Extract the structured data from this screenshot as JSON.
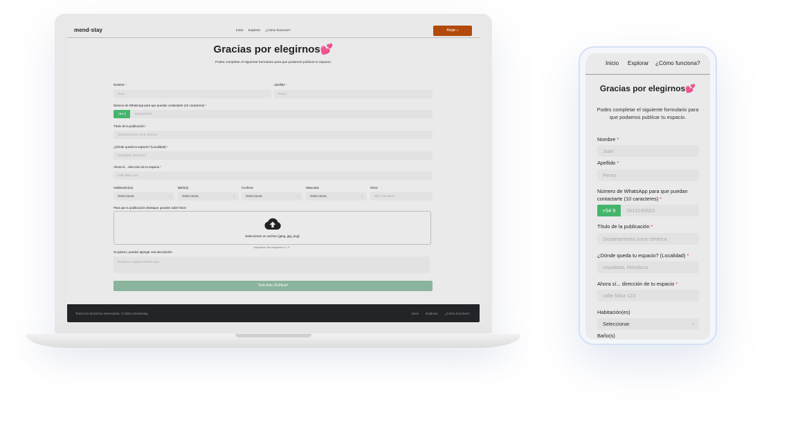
{
  "site": {
    "brand_left": "mend",
    "brand_sep": "•",
    "brand_right": "stay",
    "nav": [
      "Inicio",
      "Explorar",
      "¿Cómo funciona?"
    ],
    "cta_label": "Alojar",
    "cta_icon": "home-icon",
    "accent": "#b24a0b"
  },
  "form": {
    "title": "Gracias por elegirnos",
    "title_emoji": "💕",
    "subtitle": "Podes completar el siguiente formulario para que podamos publicar tu espacio.",
    "fields": {
      "nombre": {
        "label": "Nombre",
        "placeholder": "Juan"
      },
      "apellido": {
        "label": "Apellido",
        "placeholder": "Perez"
      },
      "whatsapp": {
        "label": "Número de WhatsApp para que puedan contactarte (10 caracteres)",
        "prefix": "+54 9",
        "placeholder": "2615190623"
      },
      "titulo": {
        "label": "Título de la publicación",
        "placeholder": "Departamento zona céntrica"
      },
      "donde": {
        "label": "¿Dónde queda tu espacio? (Localidad)",
        "placeholder": "Uspallata, Mendoza"
      },
      "direccion": {
        "label": "Ahora sí... dirección de tu espacio",
        "placeholder": "calle falsa 123"
      }
    },
    "required_mark": "*",
    "selects": [
      {
        "label": "Habitación(es)",
        "value": "Seleccionar"
      },
      {
        "label": "Baño(s)",
        "value": "Seleccionar"
      },
      {
        "label": "Cochera",
        "value": "Seleccionar"
      },
      {
        "label": "Mascotas",
        "value": "Seleccionar"
      }
    ],
    "otros": {
      "label": "Otros",
      "placeholder": "Wifi, televisión"
    },
    "photos_label": "Para que tu publicación destaque ¡puedes subir fotos!",
    "upload_icon": "cloud-upload-icon",
    "upload_label": "Seleccionar un archivo (jpeg, jpg, png)",
    "upload_count": "Adjuntado las imágenes 0 / 3",
    "desc_label": "Si quieres, puedes agregar una descripción",
    "desc_placeholder": "Empieza a typear desde aquí",
    "submit_label": "Todo listo ¡Publicar!",
    "submit_color": "#8bb49c",
    "prefix_color": "#45b56c"
  },
  "footer": {
    "copyright": "Todos los derechos reservados. © 2021 mendostay.",
    "links": [
      "Inicio",
      "Explorar",
      "¿Cómo funciona?"
    ]
  },
  "mobile": {
    "nav": [
      "Inicio",
      "Explorar",
      "¿Cómo funciona?"
    ],
    "whatsapp_label_line1": "Número de WhatsApp para que puedan",
    "whatsapp_label_line2": "contactarte (10 caracteres)",
    "next_label": "Baño(s)"
  }
}
